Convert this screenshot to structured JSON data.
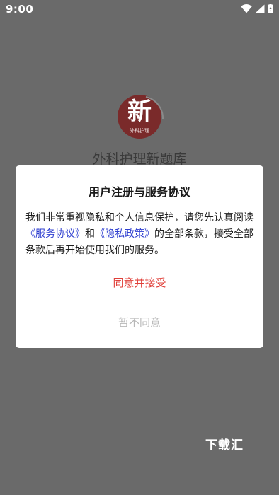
{
  "status_bar": {
    "time": "9:00",
    "icons": [
      "wifi-icon",
      "signal-icon",
      "battery-icon"
    ]
  },
  "splash": {
    "logo_char": "新",
    "logo_subtext": "外科护理",
    "app_title": "外科护理新题库"
  },
  "dialog": {
    "title": "用户注册与服务协议",
    "body_part1": "我们非常重视隐私和个人信息保护，请您先认真阅读",
    "link_service": "《服务协议》",
    "body_part2": "和",
    "link_privacy": "《隐私政策》",
    "body_part3": "的全部条款，接受全部条款后再开始使用我们的服务。",
    "agree_label": "同意并接受",
    "disagree_label": "暂不同意"
  },
  "watermark": {
    "label": "下载汇"
  },
  "colors": {
    "overlay": "#6a6a6a",
    "link": "#2f3fd0",
    "agree": "#e0403a",
    "disagree": "#b8b8b8"
  }
}
